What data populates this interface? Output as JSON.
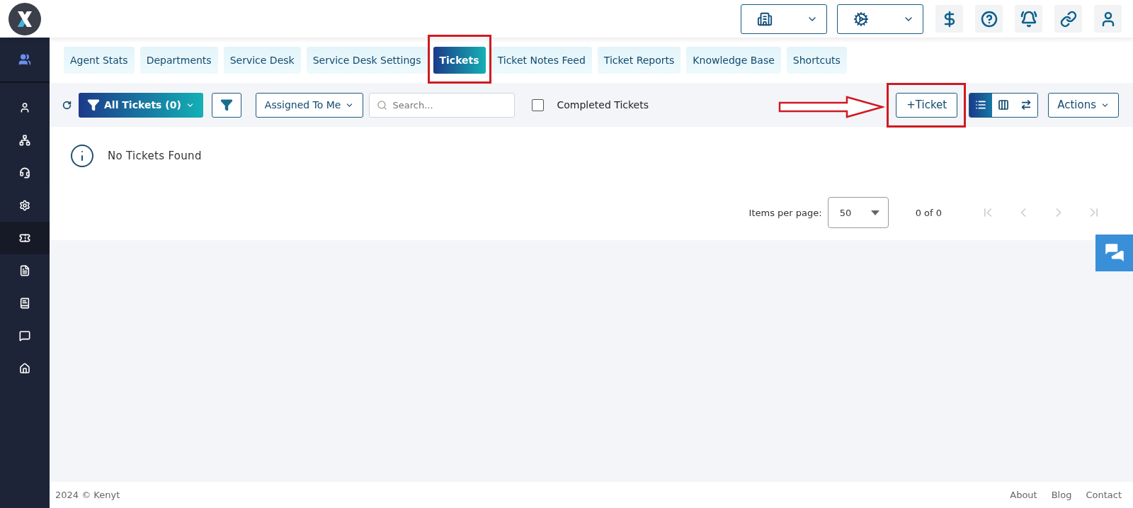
{
  "header": {
    "dropdowns": [
      {
        "kind": "building"
      },
      {
        "kind": "ai"
      }
    ],
    "icon_buttons": [
      {
        "kind": "dollar"
      },
      {
        "kind": "help"
      },
      {
        "kind": "bell"
      },
      {
        "kind": "link"
      },
      {
        "kind": "user"
      }
    ]
  },
  "sidebar": {
    "top": {
      "kind": "users"
    },
    "items": [
      {
        "kind": "user",
        "selected": false
      },
      {
        "kind": "org",
        "selected": false
      },
      {
        "kind": "headset",
        "selected": false
      },
      {
        "kind": "gear",
        "selected": false
      },
      {
        "kind": "tickets",
        "selected": true
      },
      {
        "kind": "doc",
        "selected": false
      },
      {
        "kind": "book",
        "selected": false
      },
      {
        "kind": "chat",
        "selected": false
      },
      {
        "kind": "home",
        "selected": false
      }
    ]
  },
  "tabs": [
    {
      "label": "Agent Stats",
      "selected": false,
      "annotated": false
    },
    {
      "label": "Departments",
      "selected": false,
      "annotated": false
    },
    {
      "label": "Service Desk",
      "selected": false,
      "annotated": false
    },
    {
      "label": "Service Desk Settings",
      "selected": false,
      "annotated": false
    },
    {
      "label": "Tickets",
      "selected": true,
      "annotated": true
    },
    {
      "label": "Ticket Notes Feed",
      "selected": false,
      "annotated": false
    },
    {
      "label": "Ticket Reports",
      "selected": false,
      "annotated": false
    },
    {
      "label": "Knowledge Base",
      "selected": false,
      "annotated": false
    },
    {
      "label": "Shortcuts",
      "selected": false,
      "annotated": false
    }
  ],
  "toolbar": {
    "all_tickets": "All Tickets (0)",
    "assigned": "Assigned To Me",
    "search": {
      "placeholder": "Search..."
    },
    "completed": {
      "label": "Completed Tickets",
      "checked": false
    },
    "arrow": true,
    "new_ticket": {
      "label": "+Ticket",
      "annotated": true
    },
    "views": [
      {
        "kind": "list",
        "selected": true
      },
      {
        "kind": "columns",
        "selected": false
      },
      {
        "kind": "swap",
        "selected": false
      }
    ],
    "actions": "Actions"
  },
  "empty_message": "No Tickets Found",
  "pagination": {
    "label": "Items per page:",
    "value": "50",
    "range": "0 of 0",
    "nav": [
      {
        "kind": "first",
        "disabled": true
      },
      {
        "kind": "prev",
        "disabled": true
      },
      {
        "kind": "next",
        "disabled": true
      },
      {
        "kind": "last",
        "disabled": true
      }
    ]
  },
  "footer": {
    "copyright": "2024 © Kenyt",
    "links": [
      "About",
      "Blog",
      "Contact"
    ]
  }
}
